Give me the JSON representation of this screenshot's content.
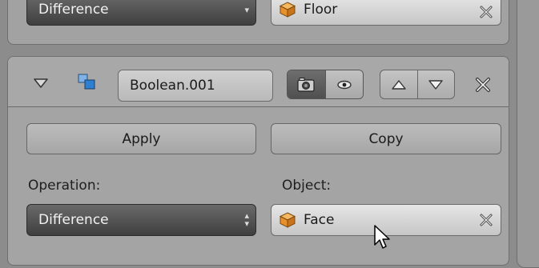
{
  "prev_modifier": {
    "operation_value": "Difference",
    "object_value": "Floor"
  },
  "modifier": {
    "name": "Boolean.001",
    "apply_label": "Apply",
    "copy_label": "Copy",
    "operation_label": "Operation:",
    "operation_value": "Difference",
    "object_label": "Object:",
    "object_value": "Face"
  },
  "colors": {
    "panel_bg": "#a4a4a4",
    "dark_select": "#4a4a4a",
    "cube_orange": "#e8902a"
  },
  "icons": [
    "collapse-triangle-icon",
    "boolean-modifier-icon",
    "render-camera-icon",
    "eye-icon",
    "move-up-icon",
    "move-down-icon",
    "close-icon",
    "cube-icon",
    "clear-x-icon",
    "mouse-cursor-icon"
  ]
}
